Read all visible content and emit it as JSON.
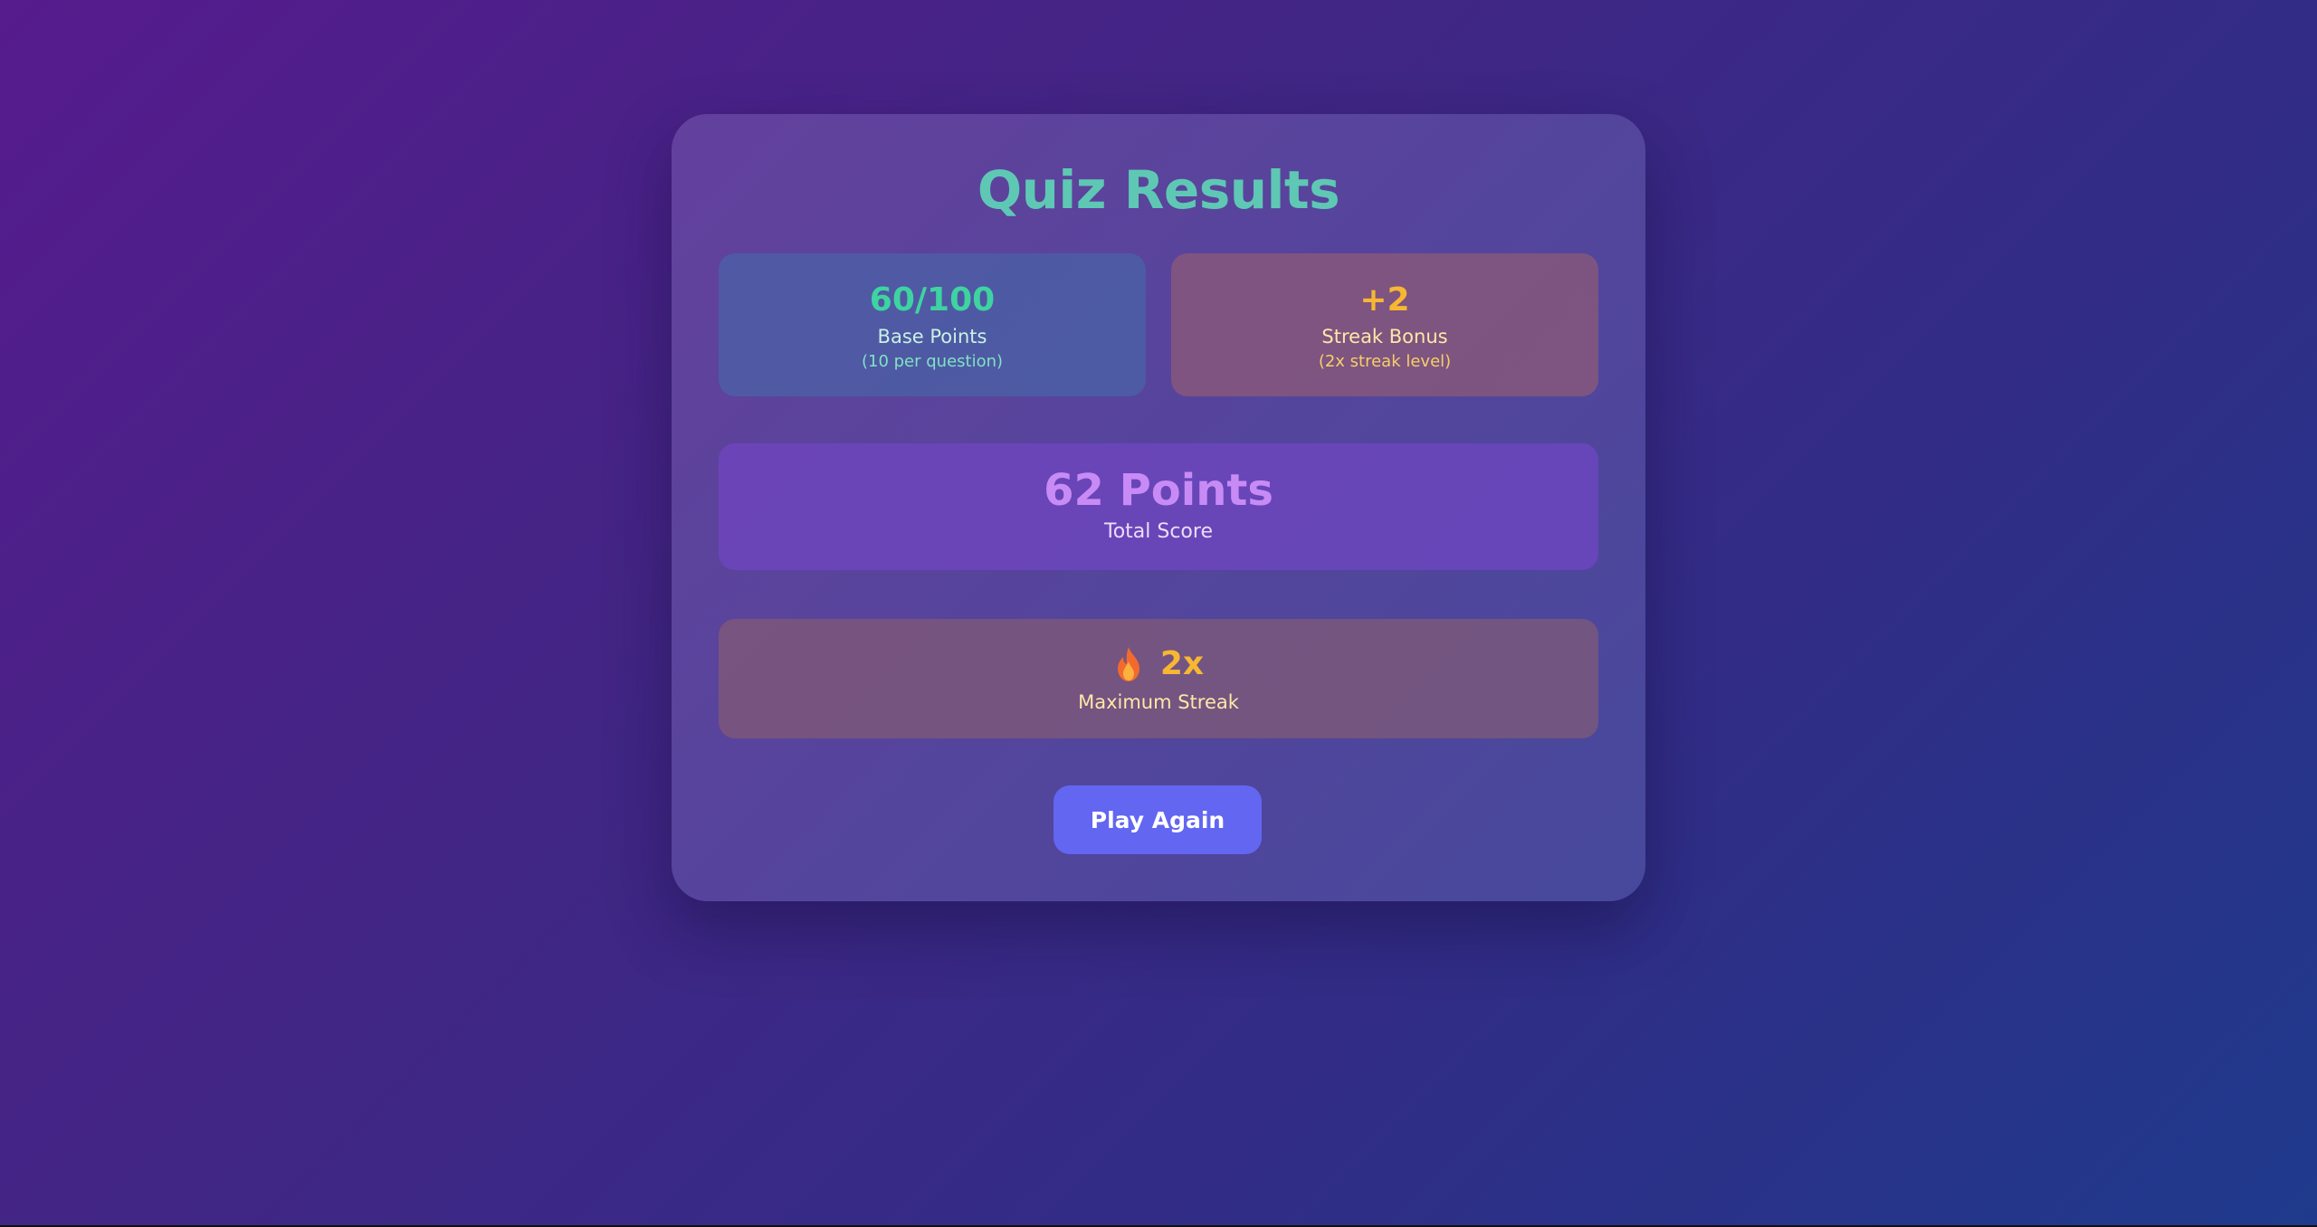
{
  "results": {
    "title": "Quiz Results",
    "base": {
      "value": "60/100",
      "label": "Base Points",
      "sub": "(10 per question)"
    },
    "streak": {
      "value": "+2",
      "label": "Streak Bonus",
      "sub": "(2x streak level)"
    },
    "total": {
      "value": "62 Points",
      "label": "Total Score"
    },
    "max_streak": {
      "icon": "fire-icon",
      "value": "2x",
      "label": "Maximum Streak"
    },
    "play_again_label": "Play Again"
  },
  "colors": {
    "title": "#5ec8b4",
    "base_accent": "#3ed3a0",
    "streak_accent": "#f7b733",
    "total_accent": "#c88bf5",
    "button": "#6366f1"
  }
}
